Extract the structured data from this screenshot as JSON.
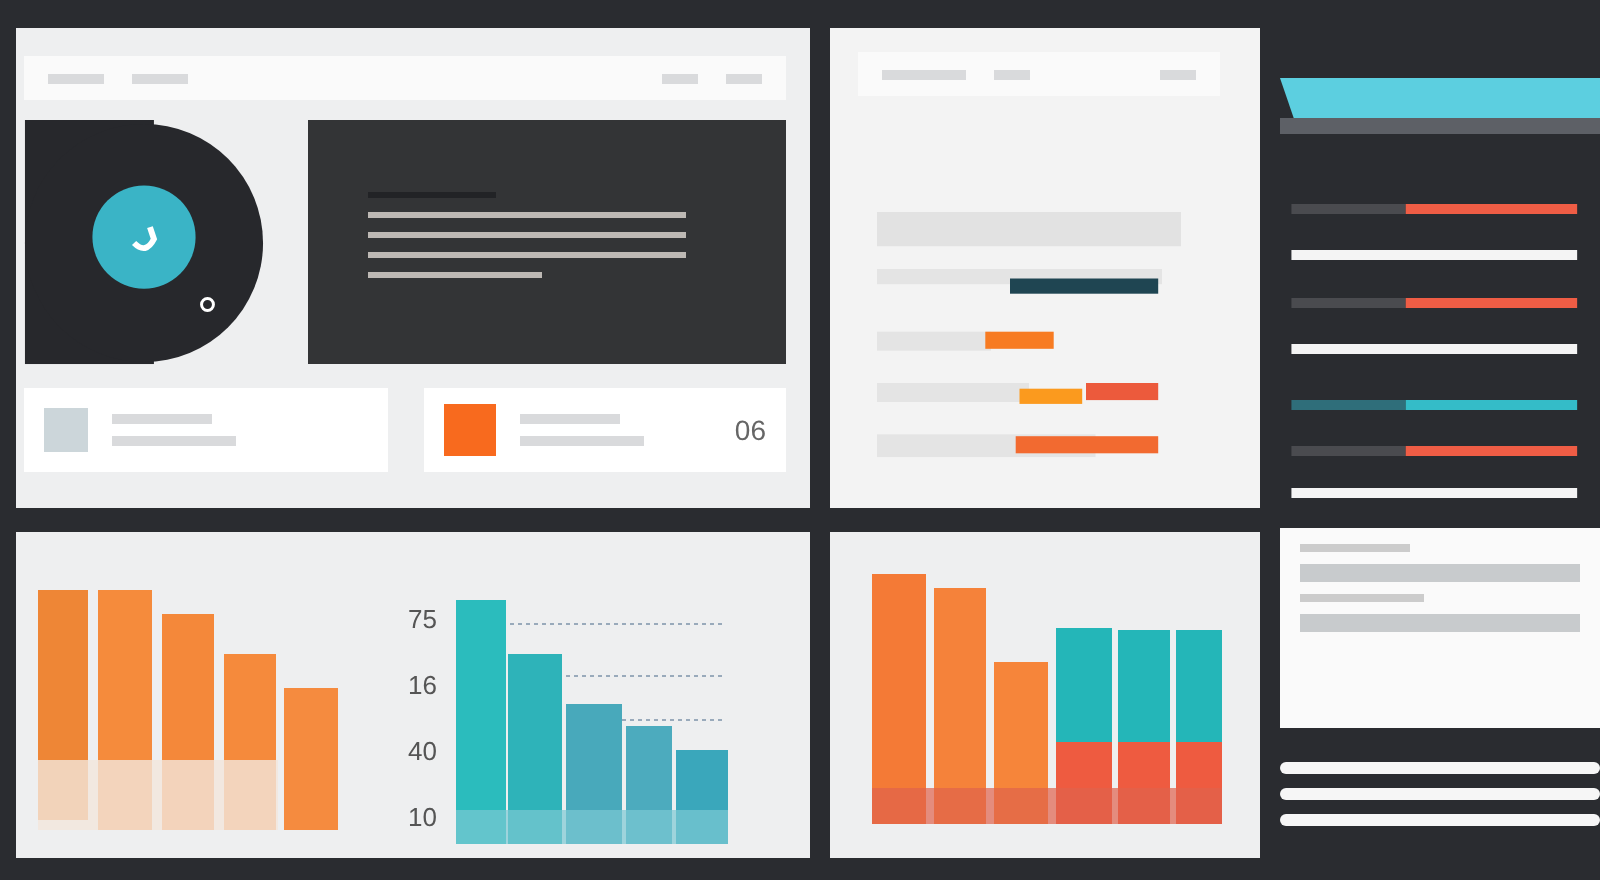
{
  "summary_card": {
    "value": "06"
  },
  "bar_chart": {
    "axis_labels": [
      "75",
      "16",
      "40",
      "10"
    ]
  }
}
